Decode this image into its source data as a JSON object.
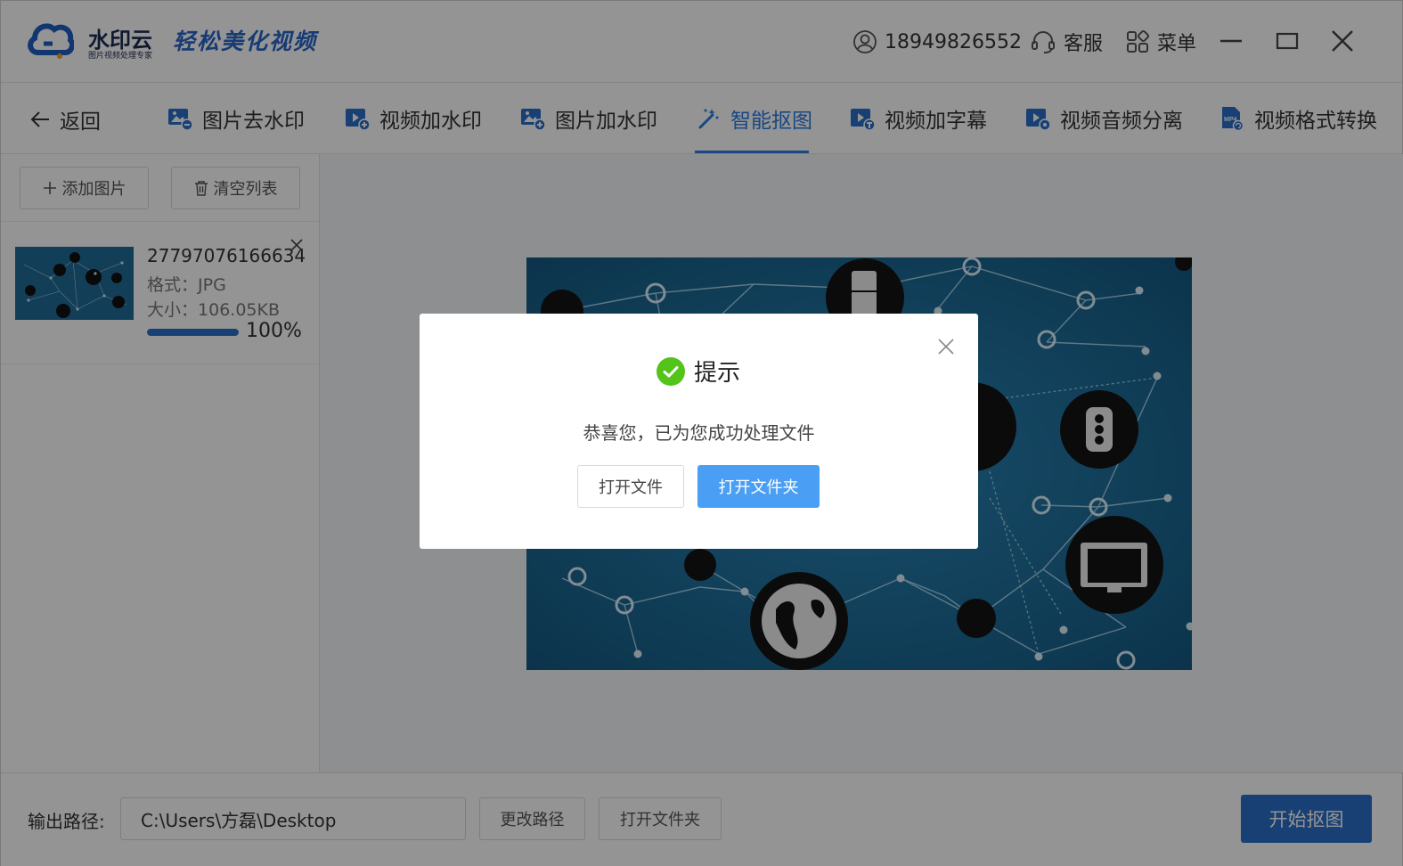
{
  "app": {
    "brand_name": "水印云",
    "brand_sub": "图片视频处理专家",
    "slogan": "轻松美化视频",
    "phone": "18949826552",
    "service_label": "客服",
    "menu_label": "菜单"
  },
  "nav": {
    "back_label": "返回",
    "tabs": [
      {
        "label": "图片去水印",
        "icon": "image-remove-icon"
      },
      {
        "label": "视频加水印",
        "icon": "video-add-icon"
      },
      {
        "label": "图片加水印",
        "icon": "image-add-icon"
      },
      {
        "label": "智能抠图",
        "icon": "magic-wand-icon",
        "active": true
      },
      {
        "label": "视频加字幕",
        "icon": "video-subtitle-icon"
      },
      {
        "label": "视频音频分离",
        "icon": "video-audio-icon"
      },
      {
        "label": "视频格式转换",
        "icon": "mp4-convert-icon"
      }
    ],
    "active_color": "#2a7ae2"
  },
  "sidebar": {
    "add_label": "添加图片",
    "clear_label": "清空列表",
    "files": [
      {
        "name": "27797076166634...",
        "format_label": "格式：",
        "format": "JPG",
        "size_label": "大小：",
        "size": "106.05KB",
        "progress_pct": 100,
        "progress_text": "100%"
      }
    ]
  },
  "footer": {
    "output_label": "输出路径:",
    "output_path": "C:\\Users\\方磊\\Desktop",
    "change_path_label": "更改路径",
    "open_folder_label": "打开文件夹",
    "start_label": "开始抠图",
    "accent": "#2a6ec9"
  },
  "dialog": {
    "title": "提示",
    "message": "恭喜您，已为您成功处理文件",
    "open_file_label": "打开文件",
    "open_folder_label": "打开文件夹",
    "success_color": "#52c41a",
    "primary_color": "#4a9ff5"
  }
}
